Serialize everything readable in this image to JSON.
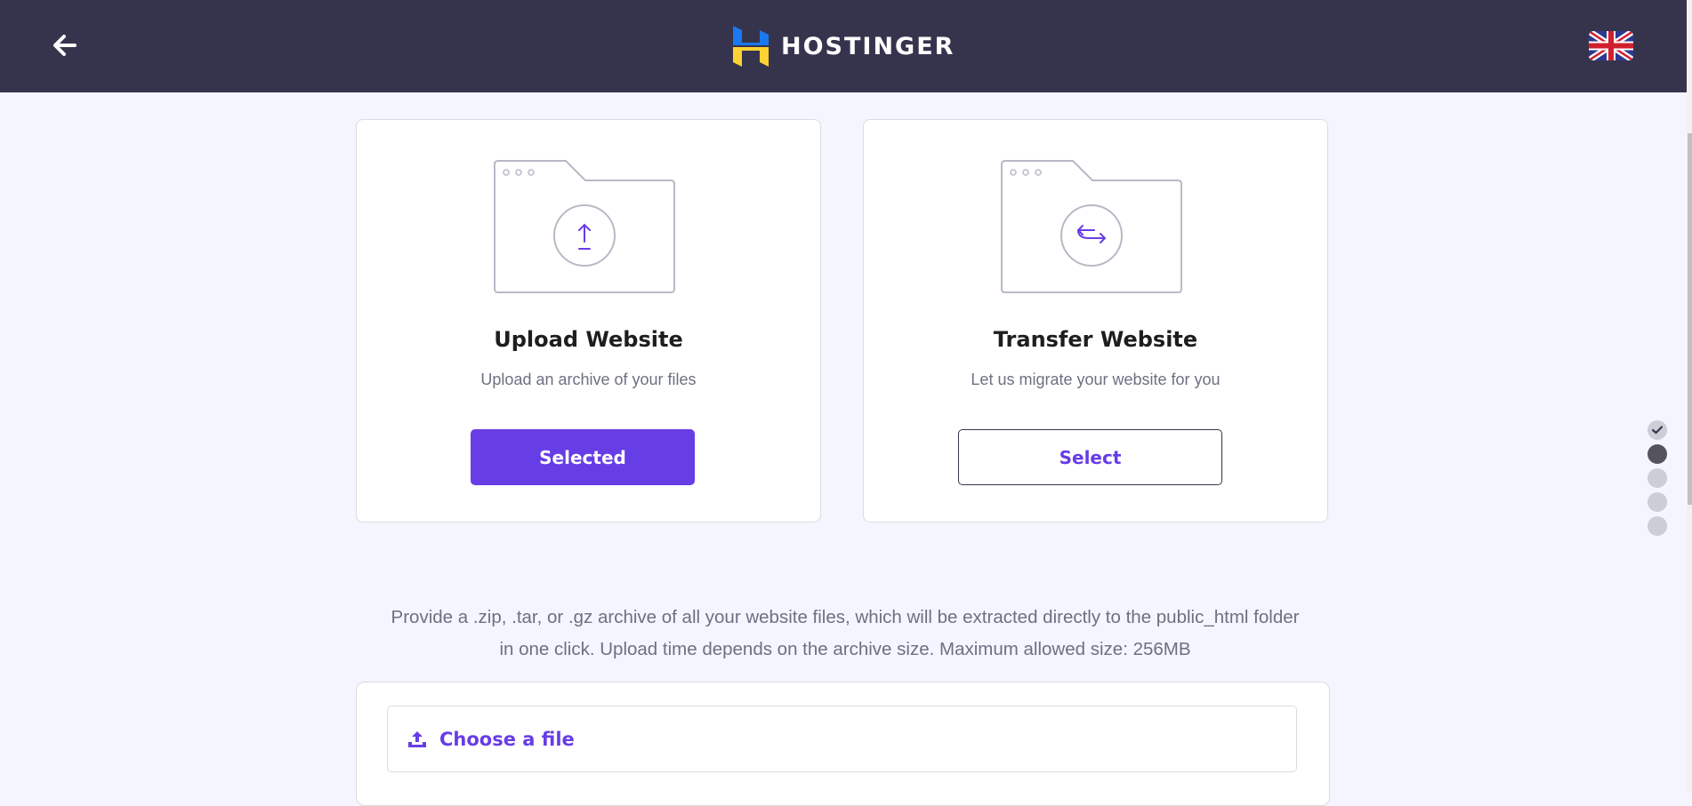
{
  "header": {
    "brand": "HOSTINGER",
    "back_icon": "arrow-left-icon",
    "language_icon": "uk-flag-icon"
  },
  "options": [
    {
      "title": "Upload Website",
      "description": "Upload an archive of your files",
      "button_label": "Selected",
      "selected": true,
      "icon": "upload-icon"
    },
    {
      "title": "Transfer Website",
      "description": "Let us migrate your website for you",
      "button_label": "Select",
      "selected": false,
      "icon": "transfer-icon"
    }
  ],
  "upload": {
    "info_line1": "Provide a .zip, .tar, or .gz archive of all your website files, which will be extracted directly to the public_html folder",
    "info_line2": "in one click. Upload time depends on the archive size. Maximum allowed size: 256MB",
    "choose_file_label": "Choose a file"
  },
  "steps": {
    "total": 5,
    "completed": 1,
    "current": 2
  },
  "colors": {
    "header_bg": "#36344d",
    "accent": "#673de6",
    "page_bg": "#f4f5ff"
  }
}
